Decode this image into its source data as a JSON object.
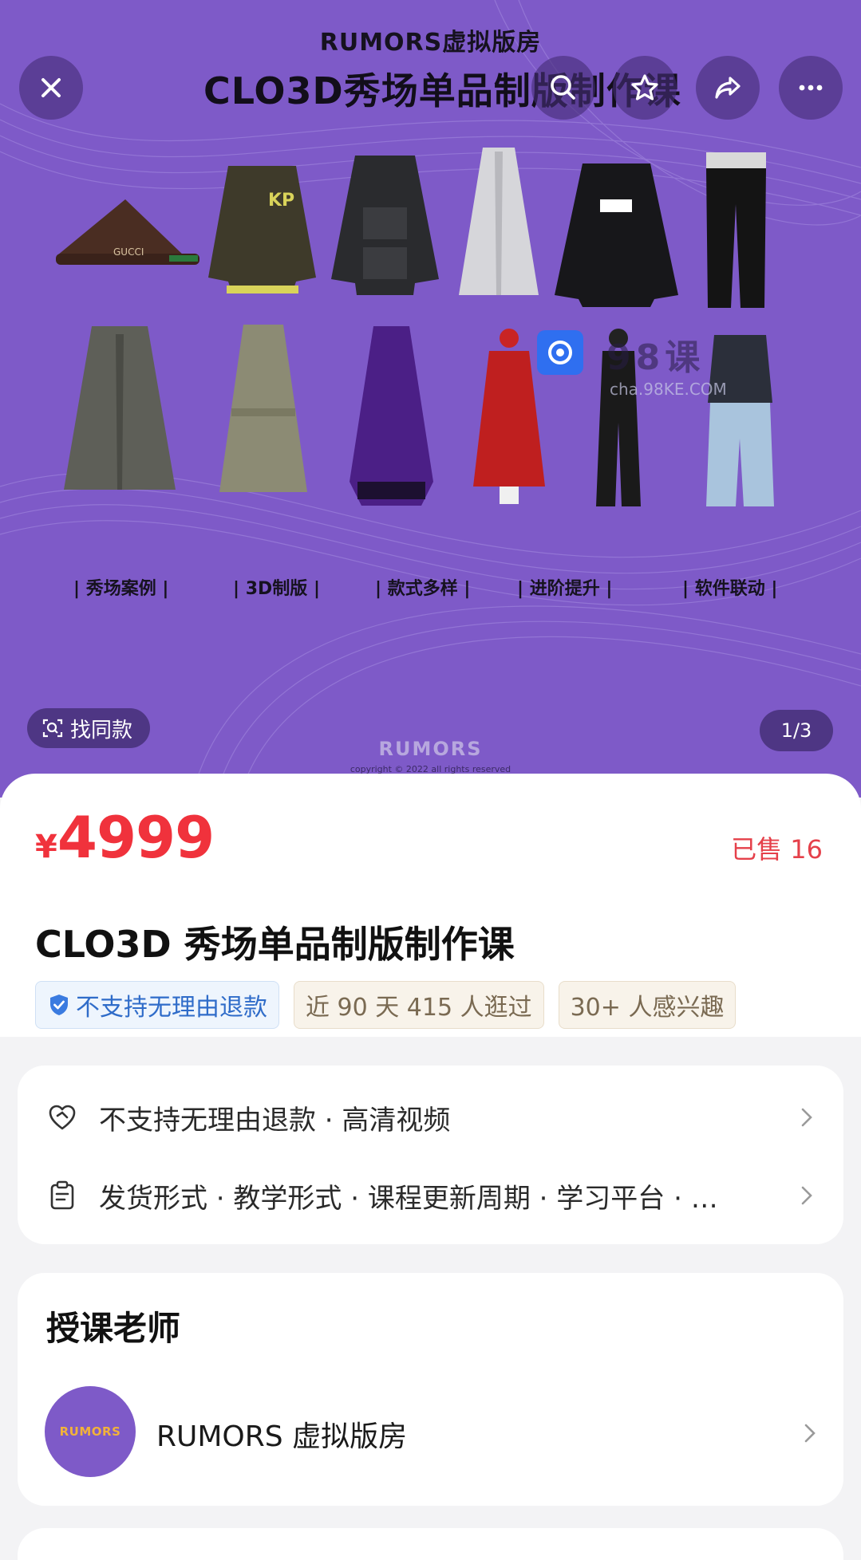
{
  "hero": {
    "brand_line": "RUMORS虚拟版房",
    "title": "CLO3D秀场单品制版制作课",
    "tags": [
      "秀场案例",
      "3D制版",
      "款式多样",
      "进阶提升",
      "软件联动"
    ],
    "footer_brand": "RUMORS",
    "copyright": "copyright © 2022 all rights reserved",
    "find_same_label": "找同款",
    "page_indicator": "1/3",
    "watermark_text": "98课",
    "watermark_sub": "cha.98KE.COM",
    "colors": {
      "background": "#7e5ac8"
    }
  },
  "toolbar": {
    "close_icon": "close-icon",
    "search_icon": "search-icon",
    "favorite_icon": "star-icon",
    "share_icon": "share-icon",
    "more_icon": "more-icon"
  },
  "product": {
    "currency": "¥",
    "price": "4999",
    "sold": "已售 16",
    "title": "CLO3D 秀场单品制版制作课",
    "badges": [
      {
        "text": "不支持无理由退款",
        "icon": "shield-check-icon"
      },
      {
        "text": "近 90 天 415 人逛过"
      },
      {
        "text": "30+ 人感兴趣"
      }
    ],
    "colors": {
      "price": "#f0323c"
    }
  },
  "info": {
    "rows": [
      {
        "icon": "heart-shield-icon",
        "text": "不支持无理由退款 · 高清视频"
      },
      {
        "icon": "clipboard-icon",
        "text": "发货形式 · 教学形式 · 课程更新周期 · 学习平台 · …"
      }
    ]
  },
  "teacher": {
    "heading": "授课老师",
    "avatar_text": "RUMORS",
    "name": "RUMORS 虚拟版房"
  }
}
